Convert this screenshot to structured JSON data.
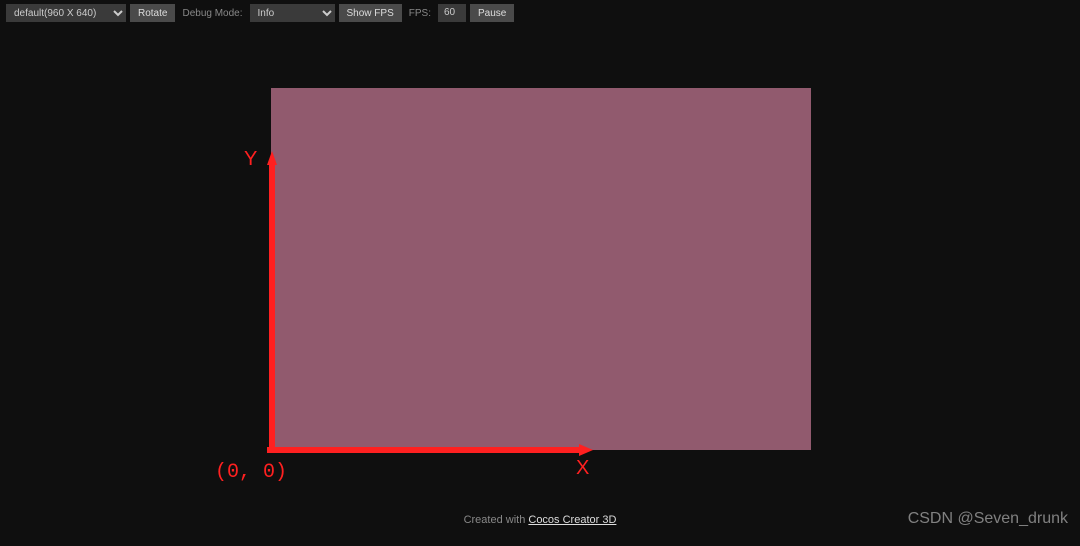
{
  "toolbar": {
    "resolution_selected": "default(960 X 640)",
    "rotate_label": "Rotate",
    "debug_mode_label": "Debug Mode:",
    "debug_mode_selected": "Info",
    "show_fps_label": "Show FPS",
    "fps_label": "FPS:",
    "fps_value": "60",
    "pause_label": "Pause"
  },
  "annotation": {
    "y_axis_label": "Y",
    "x_axis_label": "X",
    "origin_label": "(0, 0)"
  },
  "footer": {
    "created_with": "Created with ",
    "link_text": "Cocos Creator 3D"
  },
  "watermark": "CSDN @Seven_drunk"
}
